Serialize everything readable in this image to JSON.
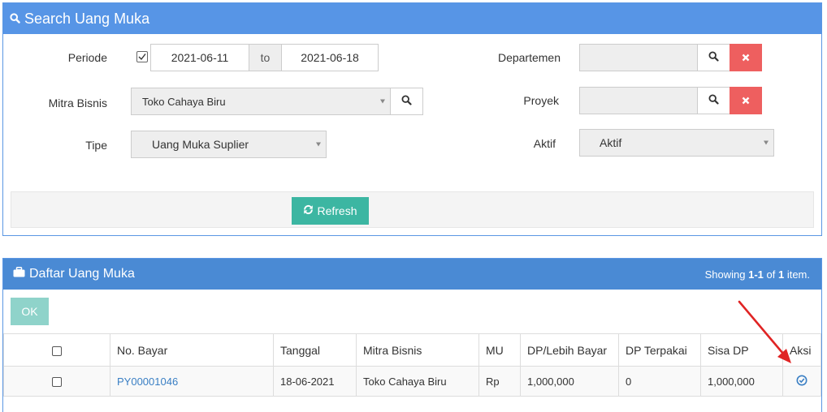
{
  "search_panel": {
    "title": "Search Uang Muka",
    "periode_label": "Periode",
    "periode_enabled": true,
    "date_from": "2021-06-11",
    "to_label": "to",
    "date_to": "2021-06-18",
    "mitra_label": "Mitra Bisnis",
    "mitra_value": "Toko Cahaya Biru",
    "tipe_label": "Tipe",
    "tipe_value": "Uang Muka Suplier",
    "departemen_label": "Departemen",
    "departemen_value": "",
    "proyek_label": "Proyek",
    "proyek_value": "",
    "aktif_label": "Aktif",
    "aktif_value": "Aktif",
    "refresh_label": "Refresh"
  },
  "list_panel": {
    "title": "Daftar Uang Muka",
    "summary_prefix": "Showing ",
    "summary_range": "1-1",
    "summary_of": " of ",
    "summary_total": "1",
    "summary_suffix": " item.",
    "ok_label": "OK",
    "columns": [
      "No. Bayar",
      "Tanggal",
      "Mitra Bisnis",
      "MU",
      "DP/Lebih Bayar",
      "DP Terpakai",
      "Sisa DP",
      "Aksi"
    ],
    "rows": [
      {
        "no_bayar": "PY00001046",
        "tanggal": "18-06-2021",
        "mitra": "Toko Cahaya Biru",
        "mu": "Rp",
        "dp_lebih_bayar": "1,000,000",
        "dp_terpakai": "0",
        "sisa_dp": "1,000,000"
      }
    ]
  },
  "colors": {
    "header_blue": "#5795e6",
    "list_header_blue": "#4a8ad4",
    "refresh_teal": "#3cb6a2",
    "clear_red": "#ee5f5f",
    "annotation_arrow": "#e02424"
  },
  "icons": [
    "search-icon",
    "times-icon",
    "refresh-icon",
    "briefcase-icon",
    "check-circle-icon",
    "checkbox-checked-icon"
  ]
}
